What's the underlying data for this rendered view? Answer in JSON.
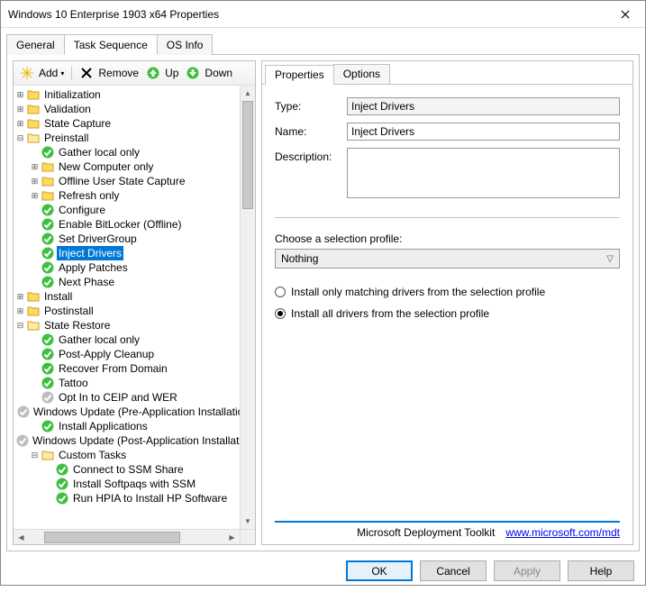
{
  "window": {
    "title": "Windows 10 Enterprise 1903 x64 Properties"
  },
  "tabs": {
    "general": "General",
    "task_sequence": "Task Sequence",
    "os_info": "OS Info"
  },
  "toolbar": {
    "add": "Add",
    "remove": "Remove",
    "up": "Up",
    "down": "Down"
  },
  "tree": {
    "initialization": "Initialization",
    "validation": "Validation",
    "state_capture": "State Capture",
    "preinstall": "Preinstall",
    "gather_local_only": "Gather local only",
    "new_computer_only": "New Computer only",
    "offline_user_state_capture": "Offline User State Capture",
    "refresh_only": "Refresh only",
    "configure": "Configure",
    "enable_bitlocker": "Enable BitLocker (Offline)",
    "set_drivergroup": "Set DriverGroup",
    "inject_drivers": "Inject Drivers",
    "apply_patches": "Apply Patches",
    "next_phase": "Next Phase",
    "install": "Install",
    "postinstall": "Postinstall",
    "state_restore": "State Restore",
    "sr_gather_local_only": "Gather local only",
    "post_apply_cleanup": "Post-Apply Cleanup",
    "recover_from_domain": "Recover From Domain",
    "tattoo": "Tattoo",
    "opt_in_ceip": "Opt In to CEIP and WER",
    "wu_pre": "Windows Update (Pre-Application Installation)",
    "install_applications": "Install Applications",
    "wu_post": "Windows Update (Post-Application Installation)",
    "custom_tasks": "Custom Tasks",
    "connect_ssm": "Connect to SSM Share",
    "install_softpaqs": "Install Softpaqs with SSM",
    "run_hpia": "Run HPIA to Install HP Software"
  },
  "props": {
    "tab_properties": "Properties",
    "tab_options": "Options",
    "type_label": "Type:",
    "type_value": "Inject Drivers",
    "name_label": "Name:",
    "name_value": "Inject Drivers",
    "desc_label": "Description:",
    "desc_value": "",
    "choose_profile": "Choose a selection profile:",
    "profile_value": "Nothing",
    "opt_matching": "Install only matching drivers from the selection profile",
    "opt_all": "Install all drivers from the selection profile",
    "footer_product": "Microsoft Deployment Toolkit",
    "footer_link": "www.microsoft.com/mdt"
  },
  "buttons": {
    "ok": "OK",
    "cancel": "Cancel",
    "apply": "Apply",
    "help": "Help"
  }
}
